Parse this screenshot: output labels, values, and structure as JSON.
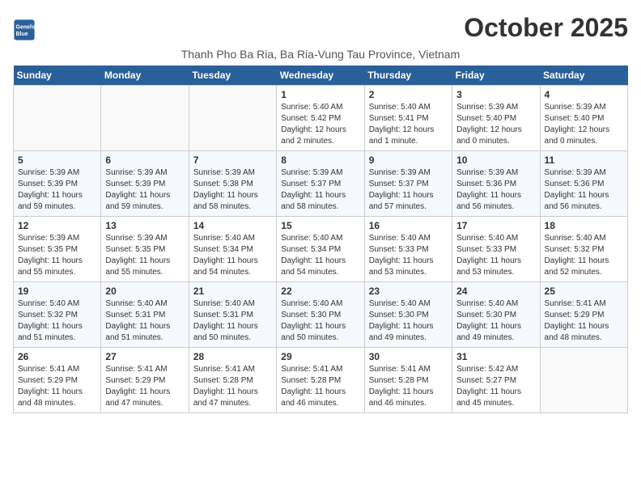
{
  "header": {
    "logo_line1": "General",
    "logo_line2": "Blue",
    "month_title": "October 2025",
    "subtitle": "Thanh Pho Ba Ria, Ba Ria-Vung Tau Province, Vietnam"
  },
  "weekdays": [
    "Sunday",
    "Monday",
    "Tuesday",
    "Wednesday",
    "Thursday",
    "Friday",
    "Saturday"
  ],
  "weeks": [
    [
      {
        "day": "",
        "info": ""
      },
      {
        "day": "",
        "info": ""
      },
      {
        "day": "",
        "info": ""
      },
      {
        "day": "1",
        "info": "Sunrise: 5:40 AM\nSunset: 5:42 PM\nDaylight: 12 hours\nand 2 minutes."
      },
      {
        "day": "2",
        "info": "Sunrise: 5:40 AM\nSunset: 5:41 PM\nDaylight: 12 hours\nand 1 minute."
      },
      {
        "day": "3",
        "info": "Sunrise: 5:39 AM\nSunset: 5:40 PM\nDaylight: 12 hours\nand 0 minutes."
      },
      {
        "day": "4",
        "info": "Sunrise: 5:39 AM\nSunset: 5:40 PM\nDaylight: 12 hours\nand 0 minutes."
      }
    ],
    [
      {
        "day": "5",
        "info": "Sunrise: 5:39 AM\nSunset: 5:39 PM\nDaylight: 11 hours\nand 59 minutes."
      },
      {
        "day": "6",
        "info": "Sunrise: 5:39 AM\nSunset: 5:39 PM\nDaylight: 11 hours\nand 59 minutes."
      },
      {
        "day": "7",
        "info": "Sunrise: 5:39 AM\nSunset: 5:38 PM\nDaylight: 11 hours\nand 58 minutes."
      },
      {
        "day": "8",
        "info": "Sunrise: 5:39 AM\nSunset: 5:37 PM\nDaylight: 11 hours\nand 58 minutes."
      },
      {
        "day": "9",
        "info": "Sunrise: 5:39 AM\nSunset: 5:37 PM\nDaylight: 11 hours\nand 57 minutes."
      },
      {
        "day": "10",
        "info": "Sunrise: 5:39 AM\nSunset: 5:36 PM\nDaylight: 11 hours\nand 56 minutes."
      },
      {
        "day": "11",
        "info": "Sunrise: 5:39 AM\nSunset: 5:36 PM\nDaylight: 11 hours\nand 56 minutes."
      }
    ],
    [
      {
        "day": "12",
        "info": "Sunrise: 5:39 AM\nSunset: 5:35 PM\nDaylight: 11 hours\nand 55 minutes."
      },
      {
        "day": "13",
        "info": "Sunrise: 5:39 AM\nSunset: 5:35 PM\nDaylight: 11 hours\nand 55 minutes."
      },
      {
        "day": "14",
        "info": "Sunrise: 5:40 AM\nSunset: 5:34 PM\nDaylight: 11 hours\nand 54 minutes."
      },
      {
        "day": "15",
        "info": "Sunrise: 5:40 AM\nSunset: 5:34 PM\nDaylight: 11 hours\nand 54 minutes."
      },
      {
        "day": "16",
        "info": "Sunrise: 5:40 AM\nSunset: 5:33 PM\nDaylight: 11 hours\nand 53 minutes."
      },
      {
        "day": "17",
        "info": "Sunrise: 5:40 AM\nSunset: 5:33 PM\nDaylight: 11 hours\nand 53 minutes."
      },
      {
        "day": "18",
        "info": "Sunrise: 5:40 AM\nSunset: 5:32 PM\nDaylight: 11 hours\nand 52 minutes."
      }
    ],
    [
      {
        "day": "19",
        "info": "Sunrise: 5:40 AM\nSunset: 5:32 PM\nDaylight: 11 hours\nand 51 minutes."
      },
      {
        "day": "20",
        "info": "Sunrise: 5:40 AM\nSunset: 5:31 PM\nDaylight: 11 hours\nand 51 minutes."
      },
      {
        "day": "21",
        "info": "Sunrise: 5:40 AM\nSunset: 5:31 PM\nDaylight: 11 hours\nand 50 minutes."
      },
      {
        "day": "22",
        "info": "Sunrise: 5:40 AM\nSunset: 5:30 PM\nDaylight: 11 hours\nand 50 minutes."
      },
      {
        "day": "23",
        "info": "Sunrise: 5:40 AM\nSunset: 5:30 PM\nDaylight: 11 hours\nand 49 minutes."
      },
      {
        "day": "24",
        "info": "Sunrise: 5:40 AM\nSunset: 5:30 PM\nDaylight: 11 hours\nand 49 minutes."
      },
      {
        "day": "25",
        "info": "Sunrise: 5:41 AM\nSunset: 5:29 PM\nDaylight: 11 hours\nand 48 minutes."
      }
    ],
    [
      {
        "day": "26",
        "info": "Sunrise: 5:41 AM\nSunset: 5:29 PM\nDaylight: 11 hours\nand 48 minutes."
      },
      {
        "day": "27",
        "info": "Sunrise: 5:41 AM\nSunset: 5:29 PM\nDaylight: 11 hours\nand 47 minutes."
      },
      {
        "day": "28",
        "info": "Sunrise: 5:41 AM\nSunset: 5:28 PM\nDaylight: 11 hours\nand 47 minutes."
      },
      {
        "day": "29",
        "info": "Sunrise: 5:41 AM\nSunset: 5:28 PM\nDaylight: 11 hours\nand 46 minutes."
      },
      {
        "day": "30",
        "info": "Sunrise: 5:41 AM\nSunset: 5:28 PM\nDaylight: 11 hours\nand 46 minutes."
      },
      {
        "day": "31",
        "info": "Sunrise: 5:42 AM\nSunset: 5:27 PM\nDaylight: 11 hours\nand 45 minutes."
      },
      {
        "day": "",
        "info": ""
      }
    ]
  ]
}
